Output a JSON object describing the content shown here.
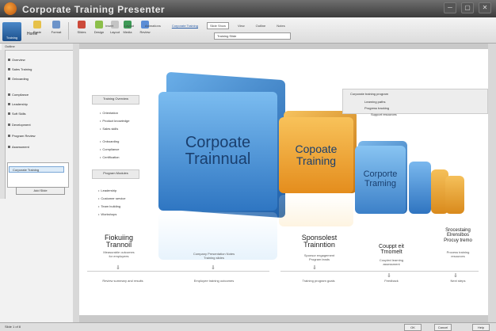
{
  "window": {
    "title": "Corporate Training Presenter",
    "controls": [
      "─",
      "▢",
      "✕"
    ]
  },
  "ribbon": {
    "menu_label": "Home",
    "logo_label": "Training",
    "buttons": [
      {
        "label": "Paste",
        "icon": "clipboard-icon",
        "color": "#e6c14a"
      },
      {
        "label": "Format",
        "icon": "format-icon",
        "color": "#6c93c9"
      },
      {
        "label": "Slides",
        "icon": "slides-icon",
        "color": "#cc4a3a"
      },
      {
        "label": "Design",
        "icon": "design-icon",
        "color": "#8cbf4a"
      },
      {
        "label": "Layout",
        "icon": "layout-icon",
        "color": "#c4c4c4"
      },
      {
        "label": "Media",
        "icon": "media-icon",
        "color": "#3d9a56"
      },
      {
        "label": "Review",
        "icon": "review-icon",
        "color": "#5b8dd6"
      }
    ],
    "strip": [
      "Insert",
      "Layout",
      "Animations",
      "Corporate Training",
      "Slide Show",
      "View",
      "Outline",
      "Notes"
    ],
    "address_value": "Training Slide"
  },
  "sidebar": {
    "header": "Outline",
    "items": [
      "Overview",
      "Sales Training",
      "Onboarding",
      "Compliance",
      "Leadership",
      "Soft Skills",
      "Development",
      "Program Review",
      "Assessment"
    ],
    "selected": "Corporate Training",
    "button": "Add Slide"
  },
  "slide": {
    "left_labels": [
      "Training Overview",
      "Program Modules"
    ],
    "bullets_top": [
      "Orientation",
      "Product knowledge",
      "Sales skills",
      "Onboarding",
      "Compliance",
      "Certification"
    ],
    "bullets_mid": [
      "Leadership",
      "Customer service",
      "Team building",
      "Workshops"
    ],
    "cubes": [
      {
        "text": "Corpoate\nTrainnual",
        "color": "#3f86cf"
      },
      {
        "text": "Copoate\nTraining",
        "color": "#efa533"
      },
      {
        "text": "Corporte\nTraming",
        "color": "#3f86cf"
      }
    ],
    "right_panel": {
      "title": "Corporate training program",
      "lines": [
        "Learning paths",
        "Progress tracking",
        "Support resources"
      ]
    },
    "captions": [
      {
        "title": "Fiokuiing\nTrannoil",
        "sub": "Measurable outcomes\nfor employees"
      },
      {
        "title": "",
        "sub": "Company Presentation Notes\nTraining slides"
      },
      {
        "title": "Sponsolest\nTrainntion",
        "sub": "Sponsor engagement\nProgram leads"
      },
      {
        "title": "Couppt eit\nTrnomelt",
        "sub": "Coupled learning\nassessment"
      },
      {
        "title": "Srocestaing\nElrenslbos\nProcuy tremo",
        "sub": "Process training\nresources"
      }
    ],
    "footer_notes": [
      "Review summary and results",
      "Employee training outcomes",
      "Training program goals",
      "Feedback",
      "Next steps"
    ]
  },
  "status": {
    "text": "Slide 1 of 8",
    "buttons": [
      "OK",
      "Cancel",
      "Help"
    ]
  }
}
